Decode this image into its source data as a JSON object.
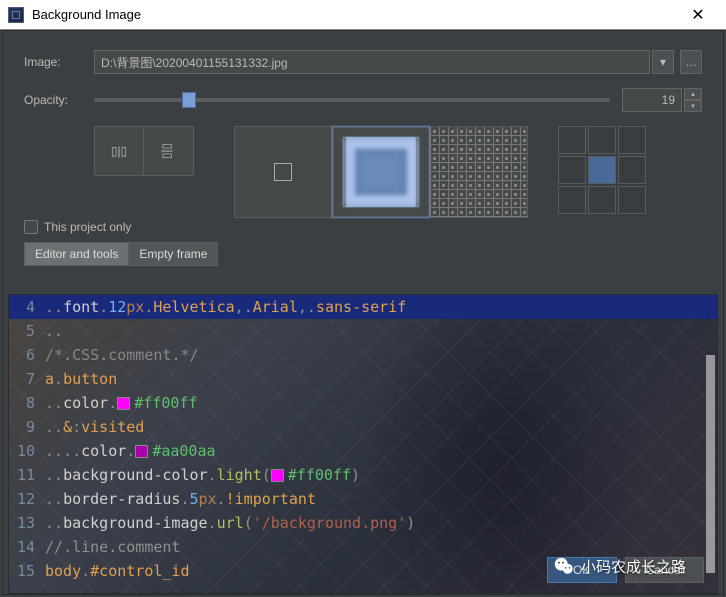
{
  "titlebar": {
    "title": "Background Image"
  },
  "labels": {
    "image": "Image:",
    "opacity": "Opacity:"
  },
  "image_path": "D:\\背景图\\20200401155131332.jpg",
  "opacity_value": "19",
  "checkbox_label": "This project only",
  "tabs": {
    "editor": "Editor and tools",
    "empty": "Empty frame"
  },
  "buttons": {
    "ok": "OK",
    "cancel": "Cancel"
  },
  "wechat_text": "小码农成长之路",
  "code": {
    "lines": [
      {
        "n": "4",
        "hl": true,
        "segs": [
          [
            "dot",
            ".."
          ],
          [
            "keyword",
            "font"
          ],
          [
            "dot",
            "."
          ],
          [
            "number",
            "12"
          ],
          [
            "unit",
            "px"
          ],
          [
            "dot",
            "."
          ],
          [
            "orange",
            "Helvetica"
          ],
          [
            "punct",
            ","
          ],
          [
            "dot",
            "."
          ],
          [
            "orange",
            "Arial"
          ],
          [
            "punct",
            ","
          ],
          [
            "dot",
            "."
          ],
          [
            "orange",
            "sans-serif"
          ]
        ]
      },
      {
        "n": "5",
        "segs": [
          [
            "dot",
            ".."
          ]
        ]
      },
      {
        "n": "6",
        "segs": [
          [
            "comment",
            "/*"
          ],
          [
            "dot",
            "."
          ],
          [
            "comment",
            "CSS"
          ],
          [
            "dot",
            "."
          ],
          [
            "comment",
            "comment"
          ],
          [
            "dot",
            "."
          ],
          [
            "comment",
            "*/"
          ]
        ]
      },
      {
        "n": "7",
        "segs": [
          [
            "orange",
            "a"
          ],
          [
            "dot",
            "."
          ],
          [
            "orange",
            "button"
          ]
        ]
      },
      {
        "n": "8",
        "segs": [
          [
            "dot",
            ".."
          ],
          [
            "keyword",
            "color"
          ],
          [
            "dot",
            "."
          ],
          [
            "hex",
            "#ff00ff",
            "#ff00ff"
          ]
        ]
      },
      {
        "n": "9",
        "segs": [
          [
            "dot",
            ".."
          ],
          [
            "orange",
            "&"
          ],
          [
            "punct",
            ":"
          ],
          [
            "orange",
            "visited"
          ]
        ]
      },
      {
        "n": "10",
        "segs": [
          [
            "dot",
            "...."
          ],
          [
            "keyword",
            "color"
          ],
          [
            "dot",
            "."
          ],
          [
            "hex",
            "#aa00aa",
            "#aa00aa"
          ]
        ]
      },
      {
        "n": "11",
        "segs": [
          [
            "dot",
            ".."
          ],
          [
            "keyword",
            "background-color"
          ],
          [
            "dot",
            "."
          ],
          [
            "func",
            "light"
          ],
          [
            "punct",
            "("
          ],
          [
            "hex",
            "#ff00ff",
            "#ff00ff"
          ],
          [
            "punct",
            ")"
          ]
        ]
      },
      {
        "n": "12",
        "segs": [
          [
            "dot",
            ".."
          ],
          [
            "keyword",
            "border-radius"
          ],
          [
            "dot",
            "."
          ],
          [
            "number",
            "5"
          ],
          [
            "unit",
            "px"
          ],
          [
            "dot",
            "."
          ],
          [
            "orange",
            "!important"
          ]
        ]
      },
      {
        "n": "13",
        "segs": [
          [
            "dot",
            ".."
          ],
          [
            "keyword",
            "background-image"
          ],
          [
            "dot",
            "."
          ],
          [
            "func",
            "url"
          ],
          [
            "punct",
            "("
          ],
          [
            "string",
            "'/background.png'"
          ],
          [
            "punct",
            ")"
          ]
        ]
      },
      {
        "n": "14",
        "segs": [
          [
            "linecomment",
            "//"
          ],
          [
            "dot",
            "."
          ],
          [
            "linecomment",
            "line"
          ],
          [
            "dot",
            "."
          ],
          [
            "linecomment",
            "comment"
          ]
        ]
      },
      {
        "n": "15",
        "segs": [
          [
            "orange",
            "body"
          ],
          [
            "dot",
            "."
          ],
          [
            "orange",
            "#control_id"
          ]
        ]
      }
    ]
  }
}
